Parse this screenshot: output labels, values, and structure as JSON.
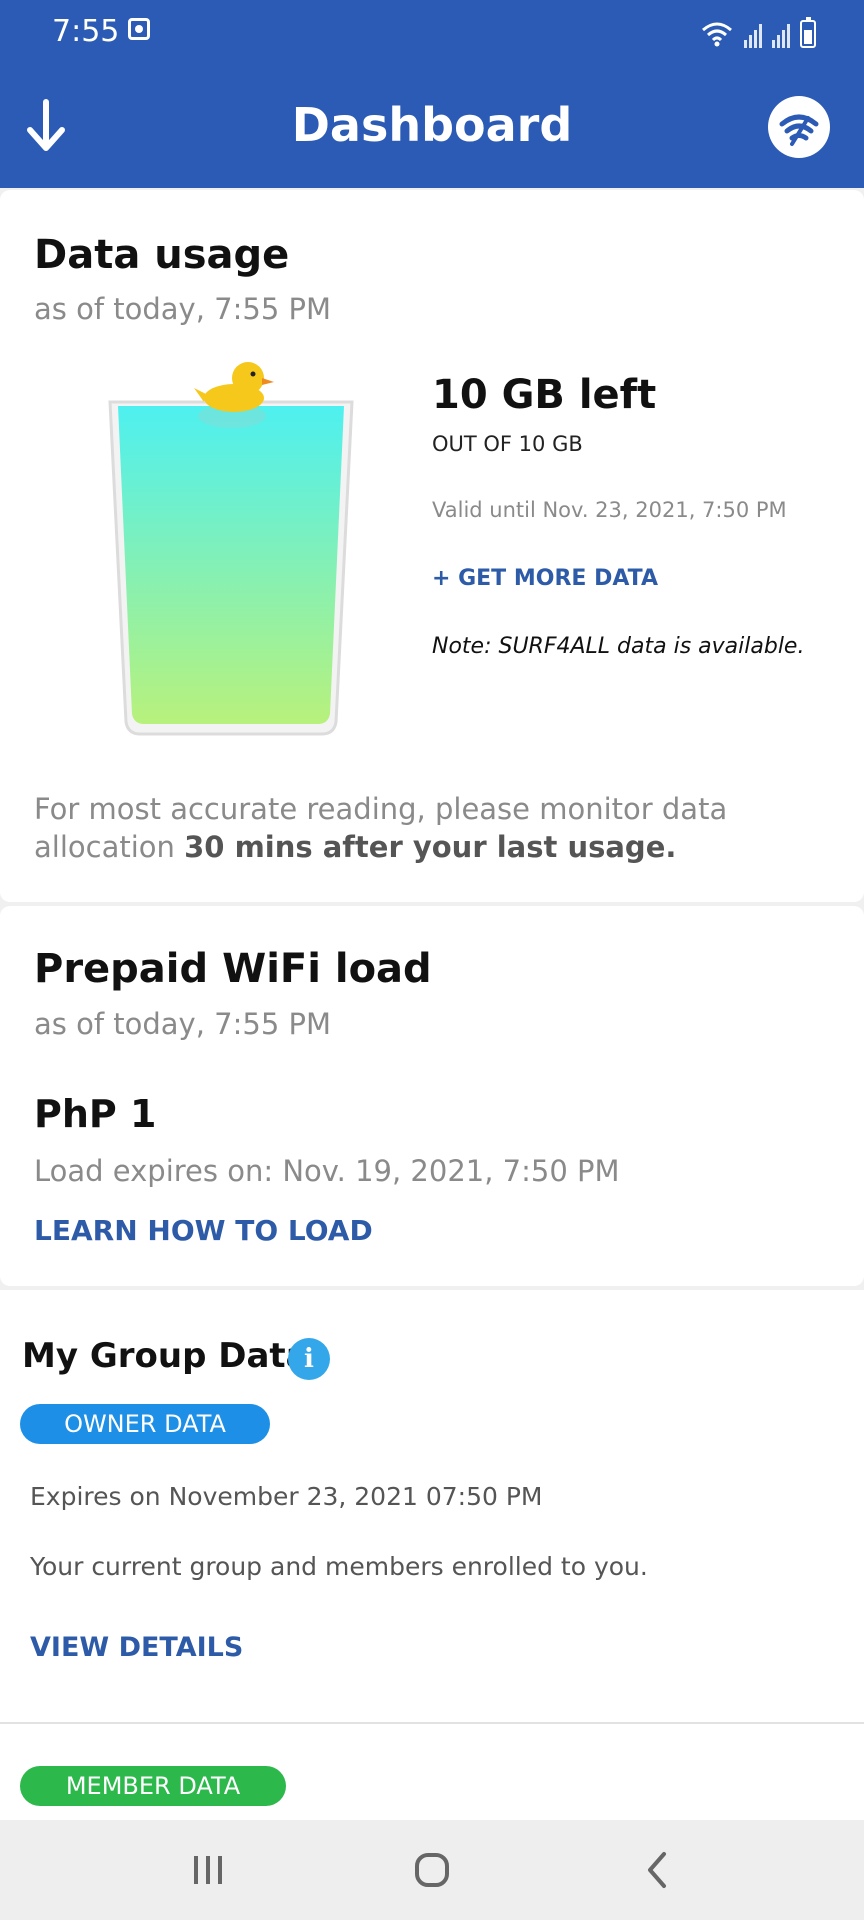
{
  "status_bar": {
    "time": "7:55",
    "icons": [
      "app-notification-icon",
      "wifi-icon",
      "signal-icon",
      "signal-icon",
      "battery-charging-icon"
    ]
  },
  "app_bar": {
    "title": "Dashboard",
    "left_icon": "download-arrow-icon",
    "right_icon": "wifi-boost-icon",
    "background": "#2b5bb5"
  },
  "data_usage": {
    "title": "Data usage",
    "as_of": "as of today, 7:55 PM",
    "remaining": "10 GB left",
    "out_of": "OUT OF 10 GB",
    "remaining_fraction": 1.0,
    "valid_until": "Valid until Nov. 23, 2021, 7:50 PM",
    "get_more_label": "+ GET MORE DATA",
    "note": "Note: SURF4ALL data is available.",
    "advice_prefix": "For most accurate reading, please monitor data allocation ",
    "advice_bold": "30 mins after your last usage."
  },
  "prepaid": {
    "title": "Prepaid WiFi load",
    "as_of": "as of today, 7:55 PM",
    "amount": "PhP 1",
    "expires": "Load expires on: Nov. 19, 2021, 7:50 PM",
    "learn_label": "LEARN HOW TO LOAD"
  },
  "group_data": {
    "title": "My Group Data",
    "info_icon": "info-icon",
    "owner_label": "OWNER DATA",
    "owner_expires": "Expires on November 23, 2021 07:50 PM",
    "owner_desc": "Your current group and members enrolled to you.",
    "view_details_label": "VIEW DETAILS",
    "member_label": "MEMBER DATA"
  },
  "nav_bar": {
    "buttons": [
      "recent-apps-icon",
      "home-icon",
      "back-icon"
    ]
  },
  "colors": {
    "accent": "#2b5bb5",
    "link": "#2d5ba8",
    "owner_pill": "#1e8fe6",
    "member_pill": "#2cb84b",
    "info": "#34a7ea"
  }
}
